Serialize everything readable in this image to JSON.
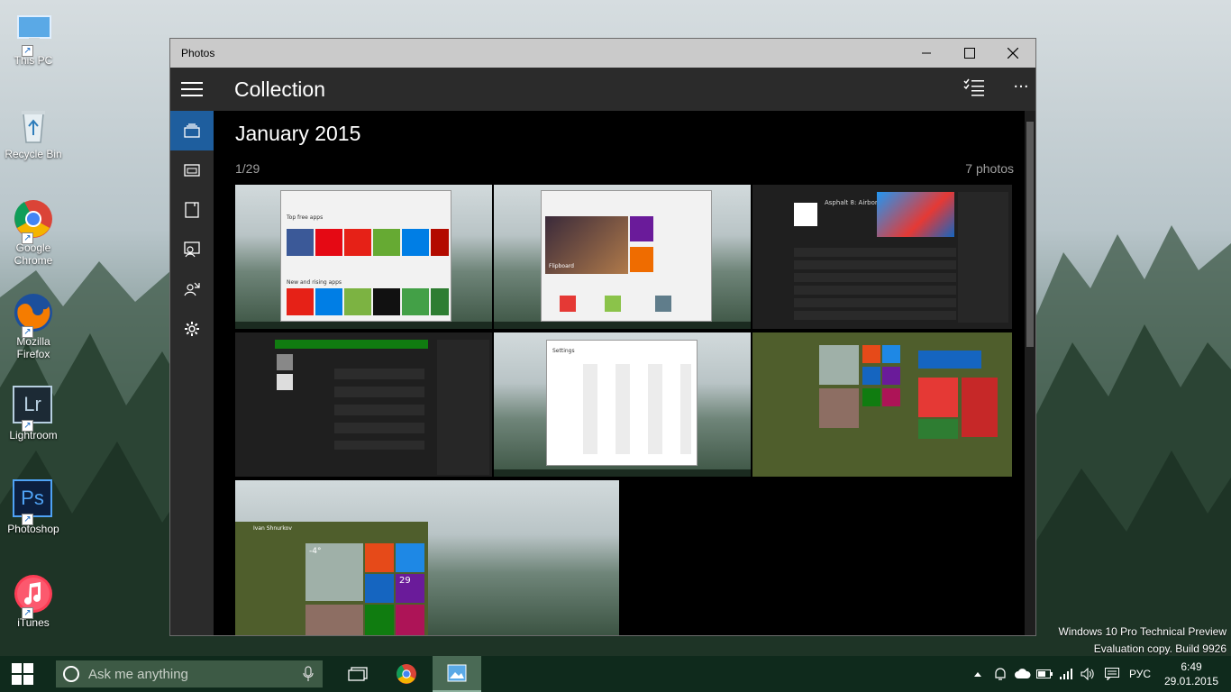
{
  "desktop": {
    "icons": [
      {
        "label": "This PC"
      },
      {
        "label": "Recycle Bin"
      },
      {
        "label": "Google Chrome"
      },
      {
        "label": "Mozilla Firefox"
      },
      {
        "label": "Lightroom"
      },
      {
        "label": "Photoshop"
      },
      {
        "label": "iTunes"
      }
    ],
    "lr_glyph": "Lr",
    "ps_glyph": "Ps",
    "watermark": {
      "line1": "Windows 10 Pro Technical Preview",
      "line2": "Evaluation copy. Build 9926"
    }
  },
  "window": {
    "title": "Photos",
    "app_title": "Collection",
    "month": "January 2015",
    "page": "1/29",
    "photo_count": "7 photos",
    "more_glyph": "···"
  },
  "thumbnails": {
    "store_title": "Top free apps",
    "store_section2": "New and rising apps",
    "flipboard": "Flipboard",
    "asphalt": "Asphalt 8: Airborne",
    "settings": "Settings",
    "weather": "-4°",
    "calendar_num": "29",
    "start_user": "Ivan Shnurkov"
  },
  "taskbar": {
    "search_placeholder": "Ask me anything",
    "language": "РУС",
    "time": "6:49",
    "date": "29.01.2015"
  },
  "colors": {
    "accent": "#1e5e9e",
    "taskbar": "#0f2a1c",
    "window_chrome": "#2b2b2b"
  }
}
